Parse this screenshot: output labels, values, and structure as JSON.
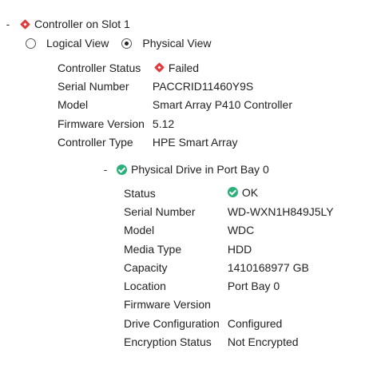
{
  "controller": {
    "toggle": "-",
    "title": "Controller on Slot 1",
    "view_options": [
      {
        "label": "Logical View",
        "selected": false
      },
      {
        "label": "Physical View",
        "selected": true
      }
    ],
    "properties": [
      {
        "label": "Controller Status",
        "value": "Failed",
        "status_icon": "failed-diamond-icon"
      },
      {
        "label": "Serial Number",
        "value": "PACCRID11460Y9S"
      },
      {
        "label": "Model",
        "value": "Smart Array P410 Controller"
      },
      {
        "label": "Firmware Version",
        "value": "5.12"
      },
      {
        "label": "Controller Type",
        "value": "HPE Smart Array"
      }
    ],
    "status_color": "#e03a3a"
  },
  "drive": {
    "toggle": "-",
    "title": "Physical Drive in Port Bay 0",
    "status_color": "#2bb07a",
    "properties": [
      {
        "label": "Status",
        "value": "OK",
        "status_icon": "ok-check-icon"
      },
      {
        "label": "Serial Number",
        "value": "WD-WXN1H849J5LY"
      },
      {
        "label": "Model",
        "value": "WDC"
      },
      {
        "label": "Media Type",
        "value": "HDD"
      },
      {
        "label": "Capacity",
        "value": "1410168977 GB"
      },
      {
        "label": "Location",
        "value": "Port Bay 0"
      },
      {
        "label": "Firmware Version",
        "value": ""
      },
      {
        "label": "Drive Configuration",
        "value": "Configured"
      },
      {
        "label": "Encryption Status",
        "value": "Not Encrypted"
      }
    ]
  }
}
